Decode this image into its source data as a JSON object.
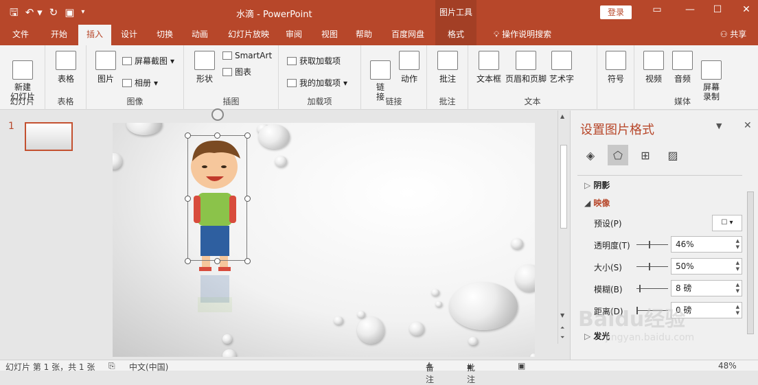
{
  "window": {
    "title": "水滴  -  PowerPoint",
    "context_tab": "图片工具",
    "login_label": "登录",
    "share_label": "共享"
  },
  "tabs": [
    "文件",
    "开始",
    "插入",
    "设计",
    "切换",
    "动画",
    "幻灯片放映",
    "审阅",
    "视图",
    "帮助",
    "百度网盘",
    "格式"
  ],
  "active_tab": "插入",
  "tell_me": "操作说明搜索",
  "ribbon": {
    "groups": {
      "slides": {
        "label": "幻灯片",
        "new_slide": "新建\n幻灯片"
      },
      "tables": {
        "label": "表格",
        "table": "表格"
      },
      "images": {
        "label": "图像",
        "picture": "图片",
        "screenshot": "屏幕截图",
        "album": "相册"
      },
      "illustrations": {
        "label": "插图",
        "shapes": "形状",
        "smartart": "SmartArt",
        "chart": "图表"
      },
      "addins": {
        "label": "加载项",
        "get_addins": "获取加载项",
        "my_addins": "我的加载项"
      },
      "links": {
        "label": "链接",
        "link": "链\n接",
        "action": "动作"
      },
      "comments": {
        "label": "批注",
        "comment": "批注"
      },
      "text": {
        "label": "文本",
        "textbox": "文本框",
        "header_footer": "页眉和页脚",
        "wordart": "艺术字"
      },
      "symbols": {
        "label": "",
        "symbol": "符号"
      },
      "media": {
        "label": "媒体",
        "video": "视频",
        "audio": "音频",
        "screen_record": "屏幕\n录制"
      }
    }
  },
  "thumbnail": {
    "number": "1"
  },
  "format_pane": {
    "title": "设置图片格式",
    "sections": {
      "shadow": "阴影",
      "reflection": "映像",
      "glow": "发光"
    },
    "props": {
      "preset": "预设(P)",
      "transparency": {
        "label": "透明度(T)",
        "value": "46%"
      },
      "size": {
        "label": "大小(S)",
        "value": "50%"
      },
      "blur": {
        "label": "模糊(B)",
        "value": "8 磅"
      },
      "distance": {
        "label": "距离(D)",
        "value": "0 磅"
      }
    }
  },
  "status": {
    "slide": "幻灯片 第 1 张，共 1 张",
    "lang": "中文(中国)",
    "notes": "备注",
    "comments": "批注",
    "zoom": "48%"
  },
  "watermark": {
    "brand": "Baidu经验",
    "url": "jingyan.baidu.com"
  }
}
